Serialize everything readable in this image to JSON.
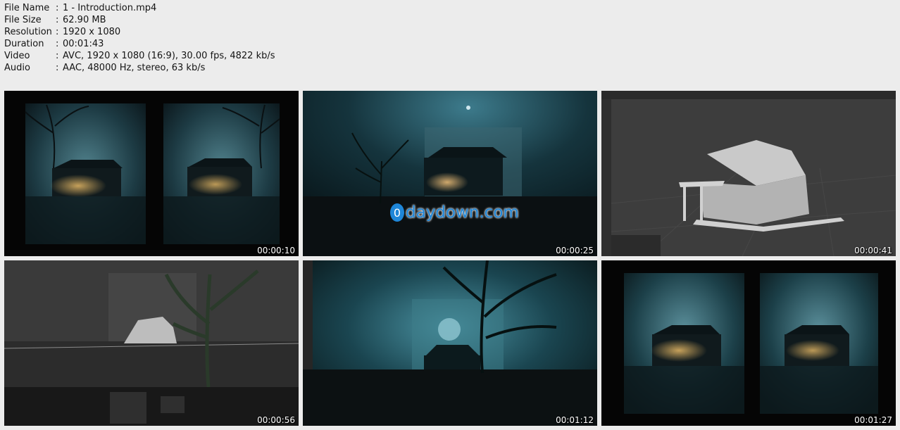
{
  "file_info": [
    {
      "key": "File Name",
      "value": "1 - Introduction.mp4"
    },
    {
      "key": "File Size",
      "value": "62.90 MB"
    },
    {
      "key": "Resolution",
      "value": "1920 x 1080"
    },
    {
      "key": "Duration",
      "value": "00:01:43"
    },
    {
      "key": "Video",
      "value": "AVC, 1920 x 1080 (16:9), 30.00 fps, 4822 kb/s"
    },
    {
      "key": "Audio",
      "value": "AAC, 48000 Hz, stereo, 63 kb/s"
    }
  ],
  "separator": ":",
  "thumbnails": [
    {
      "timestamp": "00:00:10"
    },
    {
      "timestamp": "00:00:25"
    },
    {
      "timestamp": "00:00:41"
    },
    {
      "timestamp": "00:00:56"
    },
    {
      "timestamp": "00:01:12"
    },
    {
      "timestamp": "00:01:27"
    }
  ],
  "watermark": {
    "badge": "0",
    "text": "daydown.com",
    "color": "#1e86d8"
  }
}
